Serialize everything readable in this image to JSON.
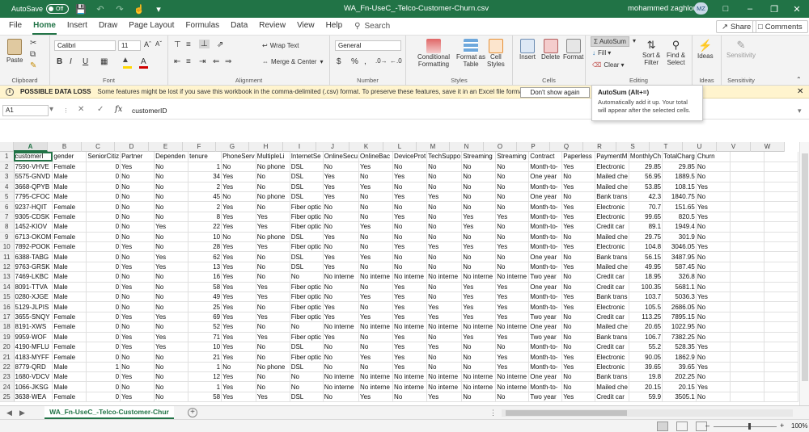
{
  "titlebar": {
    "autosave_label": "AutoSave",
    "autosave_state": "Off",
    "doc_title": "WA_Fn-UseC_-Telco-Customer-Churn.csv",
    "user_name": "mohammed zaghloul",
    "user_initials": "MZ",
    "bg_color": "#217346"
  },
  "menu": {
    "items": [
      "File",
      "Home",
      "Insert",
      "Draw",
      "Page Layout",
      "Formulas",
      "Data",
      "Review",
      "View",
      "Help"
    ],
    "active": "Home",
    "search_label": "Search",
    "share_label": "Share",
    "comments_label": "Comments"
  },
  "ribbon": {
    "clipboard": {
      "paste": "Paste",
      "label": "Clipboard"
    },
    "font": {
      "name": "Calibri",
      "size": "11",
      "label": "Font",
      "bold": "B",
      "italic": "I",
      "underline": "U"
    },
    "alignment": {
      "wrap_text": "Wrap Text",
      "merge_center": "Merge & Center",
      "label": "Alignment"
    },
    "number": {
      "format": "General",
      "label": "Number"
    },
    "styles": {
      "conditional": "Conditional",
      "formatting": "Formatting",
      "format_as": "Format as",
      "table": "Table",
      "cell": "Cell",
      "styles_btn": "Styles",
      "label": "Styles"
    },
    "cells": {
      "insert": "Insert",
      "delete": "Delete",
      "format": "Format",
      "label": "Cells"
    },
    "editing": {
      "autosum": "AutoSum",
      "fill": "Fill",
      "clear": "Clear",
      "sort_filter_1": "Sort &",
      "sort_filter_2": "Filter",
      "find_select_1": "Find &",
      "find_select_2": "Select",
      "label": "Editing"
    },
    "ideas": {
      "label_btn": "Ideas",
      "label": "Ideas"
    },
    "sensitivity": {
      "label_btn": "Sensitivity",
      "label": "Sensitivity"
    }
  },
  "infobar": {
    "title": "POSSIBLE DATA LOSS",
    "message": "Some features might be lost if you save this workbook in the comma-delimited (.csv) format. To preserve these features, save it in an Excel file format.",
    "button": "Don't show again"
  },
  "tooltip": {
    "title": "AutoSum (Alt+=)",
    "body": "Automatically add it up. Your total will appear after the selected cells."
  },
  "formula_bar": {
    "name_box": "A1",
    "fx": "fx",
    "value": "customerID"
  },
  "sheet": {
    "columns": [
      "A",
      "B",
      "C",
      "D",
      "E",
      "F",
      "G",
      "H",
      "I",
      "J",
      "K",
      "L",
      "M",
      "N",
      "O",
      "P",
      "Q",
      "R",
      "S",
      "T",
      "U",
      "V",
      "W"
    ],
    "rows": [
      [
        "customerI",
        "gender",
        "SeniorCitiz",
        "Partner",
        "Dependen",
        "tenure",
        "PhoneServ",
        "MultipleLi",
        "InternetSe",
        "OnlineSecu",
        "OnlineBac",
        "DeviceProt",
        "TechSuppo",
        "Streaming",
        "Streaming",
        "Contract",
        "Paperless",
        "PaymentM",
        "MonthlyCh",
        "TotalCharg",
        "Churn"
      ],
      [
        "7590-VHVE",
        "Female",
        "0",
        "Yes",
        "No",
        "1",
        "No",
        "No phone",
        "DSL",
        "No",
        "Yes",
        "No",
        "No",
        "No",
        "No",
        "Month-to-",
        "Yes",
        "Electronic",
        "29.85",
        "29.85",
        "No"
      ],
      [
        "5575-GNVD",
        "Male",
        "0",
        "No",
        "No",
        "34",
        "Yes",
        "No",
        "DSL",
        "Yes",
        "No",
        "Yes",
        "No",
        "No",
        "No",
        "One year",
        "No",
        "Mailed che",
        "56.95",
        "1889.5",
        "No"
      ],
      [
        "3668-QPYB",
        "Male",
        "0",
        "No",
        "No",
        "2",
        "Yes",
        "No",
        "DSL",
        "Yes",
        "Yes",
        "No",
        "No",
        "No",
        "No",
        "Month-to-",
        "Yes",
        "Mailed che",
        "53.85",
        "108.15",
        "Yes"
      ],
      [
        "7795-CFOC",
        "Male",
        "0",
        "No",
        "No",
        "45",
        "No",
        "No phone",
        "DSL",
        "Yes",
        "No",
        "Yes",
        "Yes",
        "No",
        "No",
        "One year",
        "No",
        "Bank trans",
        "42.3",
        "1840.75",
        "No"
      ],
      [
        "9237-HQIT",
        "Female",
        "0",
        "No",
        "No",
        "2",
        "Yes",
        "No",
        "Fiber optic",
        "No",
        "No",
        "No",
        "No",
        "No",
        "No",
        "Month-to-",
        "Yes",
        "Electronic",
        "70.7",
        "151.65",
        "Yes"
      ],
      [
        "9305-CDSK",
        "Female",
        "0",
        "No",
        "No",
        "8",
        "Yes",
        "Yes",
        "Fiber optic",
        "No",
        "No",
        "Yes",
        "No",
        "Yes",
        "Yes",
        "Month-to-",
        "Yes",
        "Electronic",
        "99.65",
        "820.5",
        "Yes"
      ],
      [
        "1452-KIOV",
        "Male",
        "0",
        "No",
        "Yes",
        "22",
        "Yes",
        "Yes",
        "Fiber optic",
        "No",
        "Yes",
        "No",
        "No",
        "Yes",
        "No",
        "Month-to-",
        "Yes",
        "Credit car",
        "89.1",
        "1949.4",
        "No"
      ],
      [
        "6713-OKOM",
        "Female",
        "0",
        "No",
        "No",
        "10",
        "No",
        "No phone",
        "DSL",
        "Yes",
        "No",
        "No",
        "No",
        "No",
        "No",
        "Month-to-",
        "No",
        "Mailed che",
        "29.75",
        "301.9",
        "No"
      ],
      [
        "7892-POOK",
        "Female",
        "0",
        "Yes",
        "No",
        "28",
        "Yes",
        "Yes",
        "Fiber optic",
        "No",
        "No",
        "Yes",
        "Yes",
        "Yes",
        "Yes",
        "Month-to-",
        "Yes",
        "Electronic",
        "104.8",
        "3046.05",
        "Yes"
      ],
      [
        "6388-TABG",
        "Male",
        "0",
        "No",
        "Yes",
        "62",
        "Yes",
        "No",
        "DSL",
        "Yes",
        "Yes",
        "No",
        "No",
        "No",
        "No",
        "One year",
        "No",
        "Bank trans",
        "56.15",
        "3487.95",
        "No"
      ],
      [
        "9763-GRSK",
        "Male",
        "0",
        "Yes",
        "Yes",
        "13",
        "Yes",
        "No",
        "DSL",
        "Yes",
        "No",
        "No",
        "No",
        "No",
        "No",
        "Month-to-",
        "Yes",
        "Mailed che",
        "49.95",
        "587.45",
        "No"
      ],
      [
        "7469-LKBC",
        "Male",
        "0",
        "No",
        "No",
        "16",
        "Yes",
        "No",
        "No",
        "No interne",
        "No interne",
        "No interne",
        "No interne",
        "No interne",
        "No interne",
        "Two year",
        "No",
        "Credit car",
        "18.95",
        "326.8",
        "No"
      ],
      [
        "8091-TTVA",
        "Male",
        "0",
        "Yes",
        "No",
        "58",
        "Yes",
        "Yes",
        "Fiber optic",
        "No",
        "No",
        "Yes",
        "No",
        "Yes",
        "Yes",
        "One year",
        "No",
        "Credit car",
        "100.35",
        "5681.1",
        "No"
      ],
      [
        "0280-XJGE",
        "Male",
        "0",
        "No",
        "No",
        "49",
        "Yes",
        "Yes",
        "Fiber optic",
        "No",
        "Yes",
        "Yes",
        "No",
        "Yes",
        "Yes",
        "Month-to-",
        "Yes",
        "Bank trans",
        "103.7",
        "5036.3",
        "Yes"
      ],
      [
        "5129-JLPIS",
        "Male",
        "0",
        "No",
        "No",
        "25",
        "Yes",
        "No",
        "Fiber optic",
        "Yes",
        "No",
        "Yes",
        "Yes",
        "Yes",
        "Yes",
        "Month-to-",
        "Yes",
        "Electronic",
        "105.5",
        "2686.05",
        "No"
      ],
      [
        "3655-SNQY",
        "Female",
        "0",
        "Yes",
        "Yes",
        "69",
        "Yes",
        "Yes",
        "Fiber optic",
        "Yes",
        "Yes",
        "Yes",
        "Yes",
        "Yes",
        "Yes",
        "Two year",
        "No",
        "Credit car",
        "113.25",
        "7895.15",
        "No"
      ],
      [
        "8191-XWS",
        "Female",
        "0",
        "No",
        "No",
        "52",
        "Yes",
        "No",
        "No",
        "No interne",
        "No interne",
        "No interne",
        "No interne",
        "No interne",
        "No interne",
        "One year",
        "No",
        "Mailed che",
        "20.65",
        "1022.95",
        "No"
      ],
      [
        "9959-WOF",
        "Male",
        "0",
        "Yes",
        "Yes",
        "71",
        "Yes",
        "Yes",
        "Fiber optic",
        "Yes",
        "No",
        "Yes",
        "No",
        "Yes",
        "Yes",
        "Two year",
        "No",
        "Bank trans",
        "106.7",
        "7382.25",
        "No"
      ],
      [
        "4190-MFLU",
        "Female",
        "0",
        "Yes",
        "Yes",
        "10",
        "Yes",
        "No",
        "DSL",
        "No",
        "No",
        "Yes",
        "Yes",
        "No",
        "No",
        "Month-to-",
        "No",
        "Credit car",
        "55.2",
        "528.35",
        "Yes"
      ],
      [
        "4183-MYFF",
        "Female",
        "0",
        "No",
        "No",
        "21",
        "Yes",
        "No",
        "Fiber optic",
        "No",
        "Yes",
        "Yes",
        "No",
        "No",
        "Yes",
        "Month-to-",
        "Yes",
        "Electronic",
        "90.05",
        "1862.9",
        "No"
      ],
      [
        "8779-QRD",
        "Male",
        "1",
        "No",
        "No",
        "1",
        "No",
        "No phone",
        "DSL",
        "No",
        "No",
        "Yes",
        "No",
        "No",
        "Yes",
        "Month-to-",
        "Yes",
        "Electronic",
        "39.65",
        "39.65",
        "Yes"
      ],
      [
        "1680-VDCV",
        "Male",
        "0",
        "Yes",
        "No",
        "12",
        "Yes",
        "No",
        "No",
        "No interne",
        "No interne",
        "No interne",
        "No interne",
        "No interne",
        "No interne",
        "One year",
        "No",
        "Bank trans",
        "19.8",
        "202.25",
        "No"
      ],
      [
        "1066-JKSG",
        "Male",
        "0",
        "No",
        "No",
        "1",
        "Yes",
        "No",
        "No",
        "No interne",
        "No interne",
        "No interne",
        "No interne",
        "No interne",
        "No interne",
        "Month-to-",
        "No",
        "Mailed che",
        "20.15",
        "20.15",
        "Yes"
      ],
      [
        "3638-WEA",
        "Female",
        "0",
        "Yes",
        "No",
        "58",
        "Yes",
        "Yes",
        "DSL",
        "No",
        "Yes",
        "No",
        "Yes",
        "No",
        "No",
        "Two year",
        "Yes",
        "Credit car",
        "59.9",
        "3505.1",
        "No"
      ]
    ],
    "numeric_cols": [
      2,
      5,
      18,
      19
    ],
    "tab_name": "WA_Fn-UseC_-Telco-Customer-Chur"
  },
  "status": {
    "zoom": "100%"
  }
}
